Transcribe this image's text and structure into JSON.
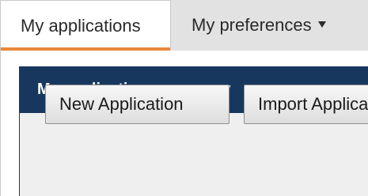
{
  "tabs": {
    "applications_label": "My applications",
    "preferences_label": "My preferences"
  },
  "panel": {
    "title": "My applications summary"
  },
  "buttons": {
    "new_application": "New Application",
    "import_application": "Import Application"
  },
  "colors": {
    "header_bg": "#17375f",
    "active_tab_underline": "#e8893a",
    "tabbar_bg": "#e2e2e2",
    "panel_bg": "#efefef"
  }
}
